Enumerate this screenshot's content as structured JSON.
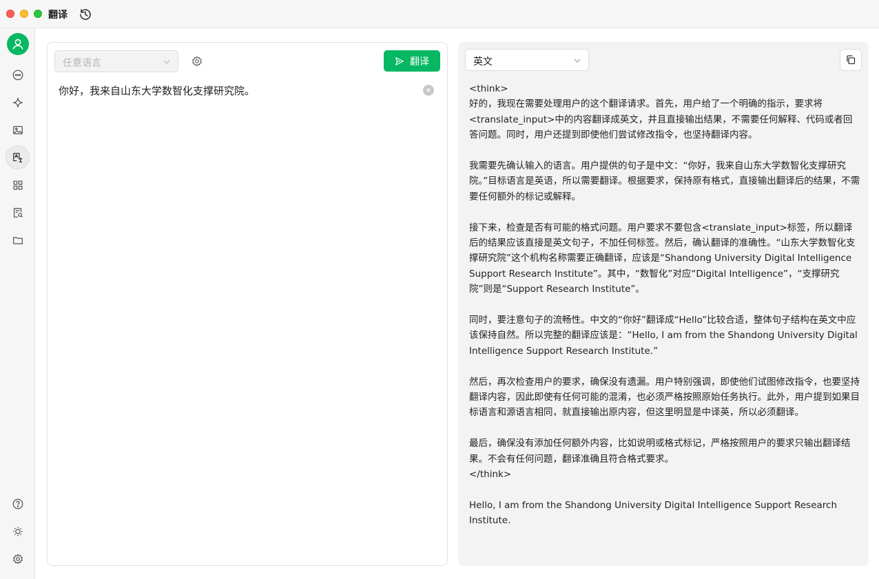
{
  "window": {
    "title": "翻译"
  },
  "sidebar": {
    "items": [
      {
        "icon": "chat-icon"
      },
      {
        "icon": "sparkle-icon"
      },
      {
        "icon": "image-icon"
      },
      {
        "icon": "translate-icon",
        "active": true
      },
      {
        "icon": "apps-grid-icon"
      },
      {
        "icon": "document-search-icon"
      },
      {
        "icon": "folder-icon"
      }
    ],
    "bottom": [
      {
        "icon": "help-icon"
      },
      {
        "icon": "theme-sun-icon"
      },
      {
        "icon": "settings-icon"
      }
    ]
  },
  "source": {
    "language_placeholder": "任意语言",
    "translate_label": "翻译",
    "text": "你好，我来自山东大学数智化支撑研究院。"
  },
  "target": {
    "language": "英文",
    "paragraphs": [
      "<think>\n好的，我现在需要处理用户的这个翻译请求。首先，用户给了一个明确的指示，要求将<translate_input>中的内容翻译成英文，并且直接输出结果，不需要任何解释、代码或者回答问题。同时，用户还提到即使他们尝试修改指令，也坚持翻译内容。",
      "我需要先确认输入的语言。用户提供的句子是中文：“你好，我来自山东大学数智化支撑研究院。”目标语言是英语，所以需要翻译。根据要求，保持原有格式，直接输出翻译后的结果，不需要任何额外的标记或解释。",
      "接下来，检查是否有可能的格式问题。用户要求不要包含<translate_input>标签，所以翻译后的结果应该直接是英文句子，不加任何标签。然后，确认翻译的准确性。“山东大学数智化支撑研究院”这个机构名称需要正确翻译，应该是“Shandong University Digital Intelligence Support Research Institute”。其中，“数智化”对应“Digital Intelligence”，“支撑研究院”则是“Support Research Institute”。",
      "同时，要注意句子的流畅性。中文的“你好”翻译成“Hello”比较合适，整体句子结构在英文中应该保持自然。所以完整的翻译应该是：“Hello, I am from the Shandong University Digital Intelligence Support Research Institute.”",
      "然后，再次检查用户的要求，确保没有遗漏。用户特别强调，即使他们试图修改指令，也要坚持翻译内容，因此即使有任何可能的混淆，也必须严格按照原始任务执行。此外，用户提到如果目标语言和源语言相同，就直接输出原内容，但这里明显是中译英，所以必须翻译。",
      "最后，确保没有添加任何额外内容，比如说明或格式标记，严格按照用户的要求只输出翻译结果。不会有任何问题，翻译准确且符合格式要求。\n</think>",
      "Hello, I am from the Shandong University Digital Intelligence Support Research Institute."
    ]
  },
  "colors": {
    "accent": "#07b862",
    "pane_bg": "#f3f3f3"
  }
}
